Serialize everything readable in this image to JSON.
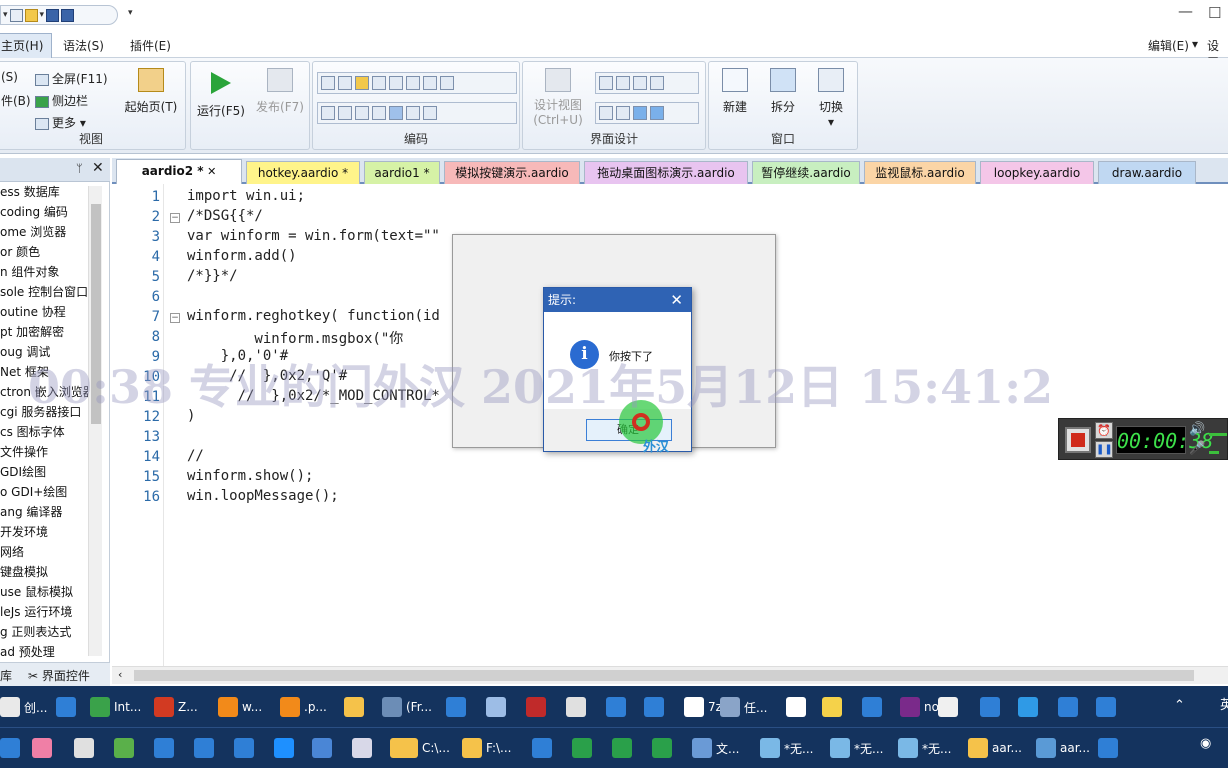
{
  "ribbon": {
    "menu_tabs": [
      "主页(H)",
      "语法(S)",
      "插件(E)"
    ],
    "right_menu": {
      "edit": "编辑(E)",
      "settings": "设置"
    },
    "view_group": {
      "label": "视图",
      "items": [
        "(S)",
        "件(B)",
        "全屏(F11)",
        "侧边栏",
        "更多",
        "起始页(T)"
      ]
    },
    "run_label": "运行(F5)",
    "publish_label": "发布(F7)",
    "code_group_label": "编码",
    "design_group": {
      "label": "界面设计",
      "design_view": "设计视图",
      "shortcut": "(Ctrl+U)"
    },
    "window_group": {
      "label": "窗口",
      "new": "新建",
      "split": "拆分",
      "switch": "切换"
    }
  },
  "sidebar": {
    "items": [
      "ess 数据库",
      "coding 编码",
      "ome 浏览器",
      "or 颜色",
      "n 组件对象",
      "sole 控制台窗口",
      "outine 协程",
      "pt 加密解密",
      "oug 调试",
      "Net 框架",
      "ctron 嵌入浏览器",
      "cgi 服务器接口",
      "cs 图标字体",
      "文件操作",
      "GDI绘图",
      "o GDI+绘图",
      "ang 编译器",
      "开发环境",
      "网络",
      "键盘模拟",
      "use 鼠标模拟",
      "leJs 运行环境",
      "g 正则表达式",
      "ad 预处理"
    ],
    "bottom_tabs": [
      "库",
      "界面控件"
    ]
  },
  "doc_tabs": [
    {
      "label": "aardio2 *",
      "color": "#ffffff",
      "active": true
    },
    {
      "label": "hotkey.aardio *",
      "color": "#fff48a"
    },
    {
      "label": "aardio1 *",
      "color": "#d6f2a6"
    },
    {
      "label": "模拟按键演示.aardio",
      "color": "#f7b9b9"
    },
    {
      "label": "拖动桌面图标演示.aardio",
      "color": "#e8c4f0"
    },
    {
      "label": "暂停继续.aardio",
      "color": "#c8efc0"
    },
    {
      "label": "监视鼠标.aardio",
      "color": "#fbd5a6"
    },
    {
      "label": "loopkey.aardio",
      "color": "#f4c6e8"
    },
    {
      "label": "draw.aardio",
      "color": "#c0d8f2"
    }
  ],
  "code_lines": [
    "import win.ui;",
    "/*DSG{{*/",
    "var winform = win.form(text=\"\"",
    "winform.add()",
    "/*}}*/",
    "",
    "winform.reghotkey( function(id",
    "        winform.msgbox(\"你",
    "    },0,'0'#",
    "     //  },0x2,'Q'#",
    "      //  },0x2/*_MOD_CONTROL*",
    ")",
    "",
    "//",
    "winform.show();",
    "win.loopMessage();"
  ],
  "line_numbers": [
    "1",
    "2",
    "3",
    "4",
    "5",
    "6",
    "7",
    "8",
    "9",
    "10",
    "11",
    "12",
    "13",
    "14",
    "15",
    "16"
  ],
  "msgbox": {
    "title": "提示:",
    "message": "你按下了",
    "ok_label": "确定",
    "cursor_mark": "外汉"
  },
  "watermark": "00:38 专业的门外汉 2021年5月12日 15:41:2",
  "recorder": {
    "time": "00:00:38"
  },
  "taskbar": {
    "row1": [
      {
        "label": "创...",
        "color": "#e9e9e9"
      },
      {
        "label": "",
        "color": "#2f7fd6"
      },
      {
        "label": "Int...",
        "color": "#3aa24a"
      },
      {
        "label": "Z...",
        "color": "#d23a22"
      },
      {
        "label": "w...",
        "color": "#f28a1a"
      },
      {
        "label": ".p...",
        "color": "#f28a1a"
      },
      {
        "label": "",
        "color": "#f5c24a"
      },
      {
        "label": "(Fr...",
        "color": "#6c8db6"
      },
      {
        "label": "",
        "color": "#2f7fd6"
      },
      {
        "label": "",
        "color": "#9dbde6"
      },
      {
        "label": "",
        "color": "#c02a2a"
      },
      {
        "label": "",
        "color": "#e0e0e0"
      },
      {
        "label": "",
        "color": "#2f7fd6"
      },
      {
        "label": "",
        "color": "#2f7fd6"
      },
      {
        "label": "7z",
        "color": "#ffffff"
      },
      {
        "label": "任...",
        "color": "#8aa4c8"
      },
      {
        "label": "",
        "color": "#ffffff"
      },
      {
        "label": "",
        "color": "#f5d24a"
      },
      {
        "label": "",
        "color": "#2f7fd6"
      },
      {
        "label": "nox",
        "color": "#7a2a8a"
      },
      {
        "label": "",
        "color": "#f0f0f0"
      },
      {
        "label": "",
        "color": "#2f7fd6"
      },
      {
        "label": "",
        "color": "#2f9ae6"
      },
      {
        "label": "",
        "color": "#2f7fd6"
      },
      {
        "label": "",
        "color": "#2f7fd6"
      }
    ],
    "row2": [
      {
        "label": "",
        "color": "#2f7fd6"
      },
      {
        "label": "",
        "color": "#f07fa6"
      },
      {
        "label": "",
        "color": "#e0e0e0"
      },
      {
        "label": "",
        "color": "#5ab04a"
      },
      {
        "label": "",
        "color": "#2f7fd6"
      },
      {
        "label": "",
        "color": "#2f7fd6"
      },
      {
        "label": "",
        "color": "#2f7fd6"
      },
      {
        "label": "",
        "color": "#1e90ff"
      },
      {
        "label": "",
        "color": "#4a86d6"
      },
      {
        "label": "",
        "color": "#d8d8e8"
      },
      {
        "label": "",
        "color": "#f5c24a"
      },
      {
        "label": "C:\\...",
        "color": "#f5c24a"
      },
      {
        "label": "F:\\...",
        "color": "#f5c24a"
      },
      {
        "label": "",
        "color": "#2f7fd6"
      },
      {
        "label": "",
        "color": "#2aa04a"
      },
      {
        "label": "",
        "color": "#2aa04a"
      },
      {
        "label": "",
        "color": "#2aa04a"
      },
      {
        "label": "文...",
        "color": "#6a9ad6"
      },
      {
        "label": "*无...",
        "color": "#7ab8e6"
      },
      {
        "label": "*无...",
        "color": "#7ab8e6"
      },
      {
        "label": "*无...",
        "color": "#7ab8e6"
      },
      {
        "label": "aar...",
        "color": "#f5c24a"
      },
      {
        "label": "aar...",
        "color": "#5a9ad6"
      },
      {
        "label": "",
        "color": "#2f7fd6"
      }
    ]
  },
  "tray": {
    "lang": "英"
  }
}
